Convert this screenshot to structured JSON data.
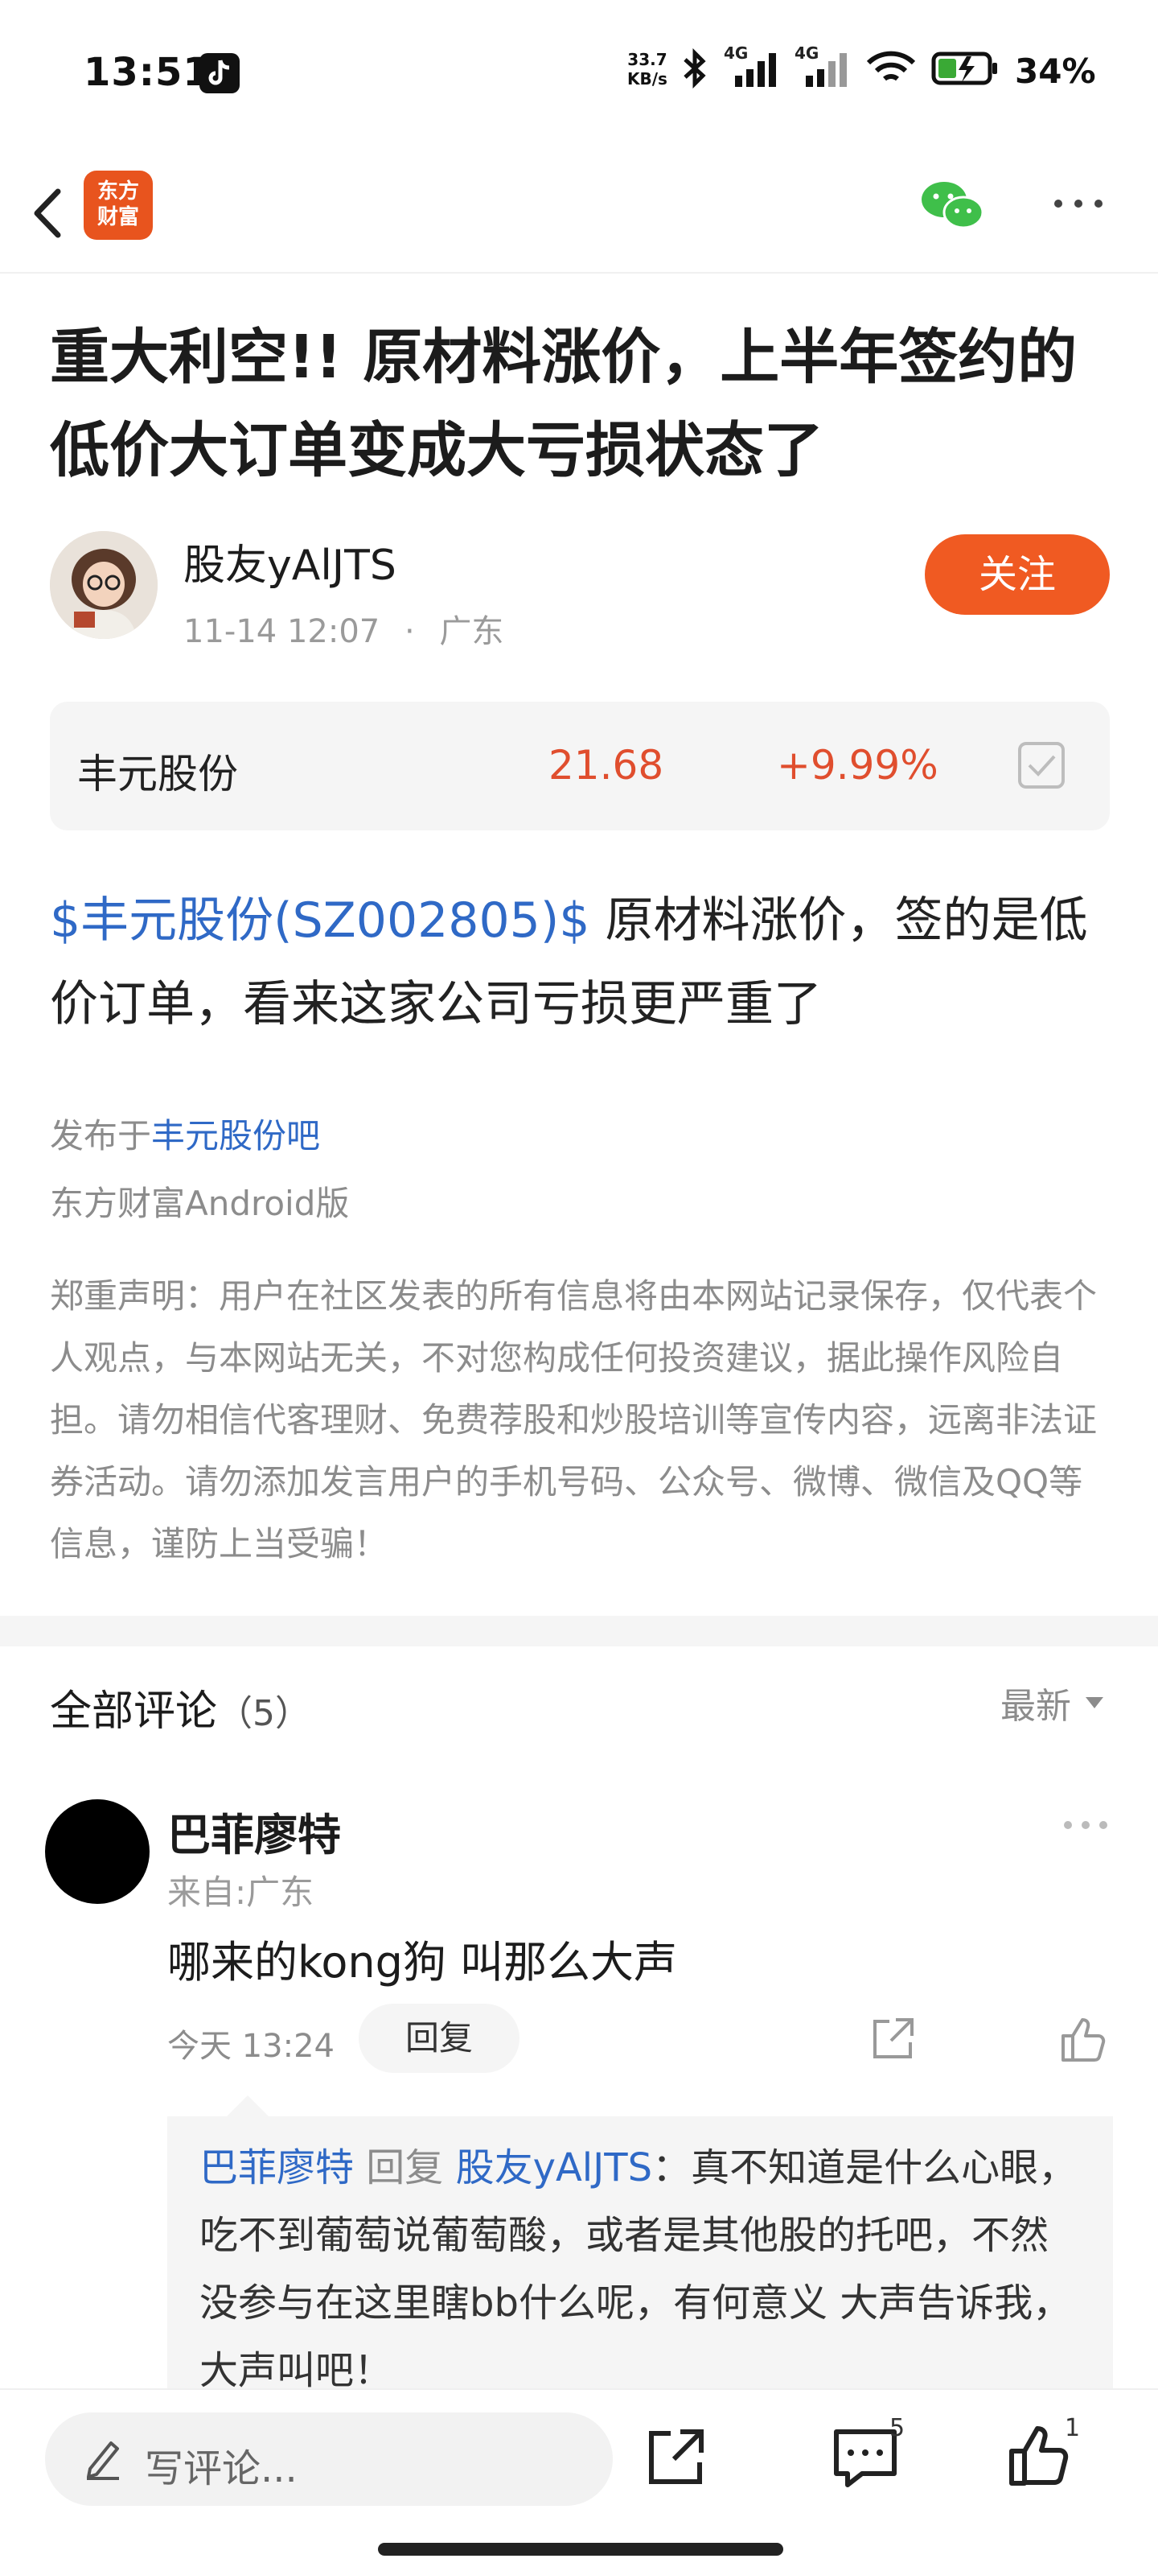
{
  "status_bar": {
    "time": "13:51",
    "net_speed_value": "33.7",
    "net_speed_unit": "KB/s",
    "network_1": "4G",
    "network_2": "4G",
    "battery": "34%"
  },
  "nav": {
    "logo_text_line1": "东方",
    "logo_text_line2": "财富"
  },
  "article": {
    "title": "重大利空!! 原材料涨价，上半年签约的低价大订单变成大亏损状态了",
    "author": {
      "name": "股友yAlJTS",
      "time": "11-14 12:07",
      "location": "广东",
      "follow_label": "关注"
    },
    "stock": {
      "name": "丰元股份",
      "price": "21.68",
      "change": "+9.99%"
    },
    "body_tag": "$丰元股份(SZ002805)$",
    "body_text": " 原材料涨价，签的是低价订单，看来这家公司亏损更严重了",
    "published_prefix": "发布于",
    "published_board": "丰元股份吧",
    "platform": "东方财富Android版",
    "disclaimer": "郑重声明：用户在社区发表的所有信息将由本网站记录保存，仅代表个人观点，与本网站无关，不对您构成任何投资建议，据此操作风险自担。请勿相信代客理财、免费荐股和炒股培训等宣传内容，远离非法证券活动。请勿添加发言用户的手机号码、公众号、微博、微信及QQ等信息，谨防上当受骗！"
  },
  "comments": {
    "heading": "全部评论",
    "count": "（5）",
    "sort_label": "最新",
    "items": [
      {
        "name": "巴菲廖特",
        "location": "来自:广东",
        "text": "哪来的kong狗 叫那么大声",
        "time": "今天 13:24",
        "reply_label": "回复",
        "reply": {
          "from": "巴菲廖特",
          "verb": "回复",
          "to": "股友yAlJTS",
          "text": "：真不知道是什么心眼，吃不到葡萄说葡萄酸，或者是其他股的托吧，不然没参与在这里瞎bb什么呢，有何意义 大声告诉我，大声叫吧！"
        }
      }
    ]
  },
  "bottom_bar": {
    "input_placeholder": "写评论...",
    "comment_count": "5",
    "like_count": "1"
  },
  "colors": {
    "brand_orange": "#f05a22",
    "link_blue": "#2f69c6",
    "stock_red": "#e04e2e"
  },
  "icons": [
    "back-icon",
    "tiktok-icon",
    "bluetooth-icon",
    "signal-icon",
    "wifi-icon",
    "battery-icon",
    "wechat-icon",
    "more-icon",
    "checkbox-icon",
    "chevron-down-icon",
    "share-icon",
    "like-icon",
    "pencil-icon",
    "comments-icon"
  ]
}
